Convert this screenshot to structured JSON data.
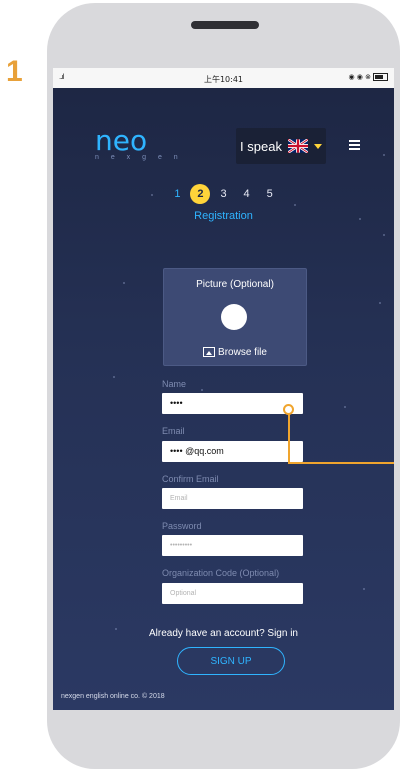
{
  "step_marker": "1",
  "status": {
    "signal": "..ıl",
    "time": "上午10:41",
    "icons": "◉ ◉ ⊗"
  },
  "logo": {
    "name": "neo",
    "subtitle": "n e x g e n"
  },
  "language": {
    "label": "I speak",
    "flag": "uk-flag-icon"
  },
  "steps": {
    "items": [
      "1",
      "2",
      "3",
      "4",
      "5"
    ],
    "current_index": 1,
    "label": "Registration"
  },
  "picture": {
    "title": "Picture (Optional)",
    "browse_label": "Browse file"
  },
  "form": {
    "name_label": "Name",
    "name_value": "••••",
    "email_label": "Email",
    "email_value": "•••• @qq.com",
    "confirm_email_label": "Confirm Email",
    "confirm_email_placeholder": "Email",
    "password_label": "Password",
    "password_placeholder": "•••••••••",
    "org_label": "Organization Code (Optional)",
    "org_placeholder": "Optional"
  },
  "signin_text": "Already have an account? Sign in",
  "signup_label": "SIGN UP",
  "footer": "nexgen english online co. © 2018",
  "colors": {
    "accent": "#2fb4ff",
    "highlight": "#ffd43a",
    "callout": "#f0a52e",
    "background": "#253155"
  }
}
